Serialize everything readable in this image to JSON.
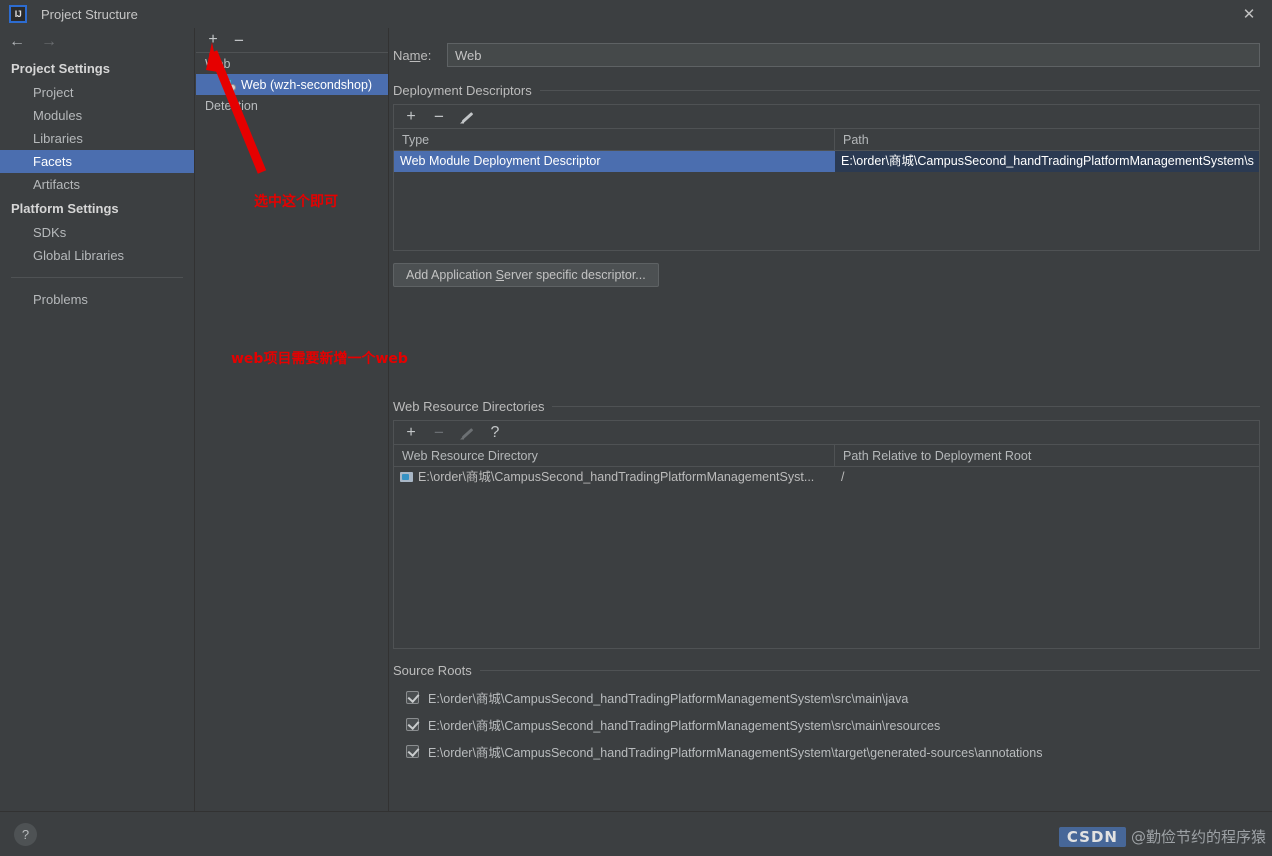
{
  "window": {
    "title": "Project Structure",
    "logo_text": "IJ",
    "close_icon": "✕"
  },
  "nav": {
    "back_icon": "←",
    "forward_icon": "→"
  },
  "sidebar": {
    "groups": [
      {
        "title": "Project Settings",
        "items": [
          {
            "label": "Project",
            "selected": false
          },
          {
            "label": "Modules",
            "selected": false
          },
          {
            "label": "Libraries",
            "selected": false
          },
          {
            "label": "Facets",
            "selected": true
          },
          {
            "label": "Artifacts",
            "selected": false
          }
        ]
      },
      {
        "title": "Platform Settings",
        "items": [
          {
            "label": "SDKs",
            "selected": false
          },
          {
            "label": "Global Libraries",
            "selected": false
          }
        ]
      }
    ],
    "problems_label": "Problems"
  },
  "tree": {
    "toolbar": {
      "add_icon": "+",
      "remove_icon": "−"
    },
    "nodes": [
      {
        "label": "Web",
        "level": 0,
        "selected": false,
        "icon": false
      },
      {
        "label": "Web (wzh-secondshop)",
        "level": 1,
        "selected": true,
        "icon": true
      },
      {
        "label": "Detection",
        "level": 0,
        "selected": false,
        "icon": false
      }
    ]
  },
  "facet": {
    "name_label": "Name:",
    "name_value": "Web",
    "deployment": {
      "section_title": "Deployment Descriptors",
      "toolbar": {
        "add_icon": "+",
        "remove_icon": "−",
        "edit_icon": "pencil"
      },
      "columns": [
        "Type",
        "Path"
      ],
      "rows": [
        {
          "type": "Web Module Deployment Descriptor",
          "path": "E:\\order\\商城\\CampusSecond_handTradingPlatformManagementSystem\\s",
          "selected": true
        }
      ],
      "add_descriptor_button": "Add Application Server specific descriptor..."
    },
    "web_resources": {
      "section_title": "Web Resource Directories",
      "toolbar": {
        "add_icon": "+",
        "remove_icon": "−",
        "edit_icon": "pencil",
        "help_icon": "?"
      },
      "columns": [
        "Web Resource Directory",
        "Path Relative to Deployment Root"
      ],
      "rows": [
        {
          "directory": "E:\\order\\商城\\CampusSecond_handTradingPlatformManagementSyst...",
          "relative_path": "/"
        }
      ]
    },
    "source_roots": {
      "section_title": "Source Roots",
      "items": [
        {
          "path": "E:\\order\\商城\\CampusSecond_handTradingPlatformManagementSystem\\src\\main\\java",
          "checked": true
        },
        {
          "path": "E:\\order\\商城\\CampusSecond_handTradingPlatformManagementSystem\\src\\main\\resources",
          "checked": true
        },
        {
          "path": "E:\\order\\商城\\CampusSecond_handTradingPlatformManagementSystem\\target\\generated-sources\\annotations",
          "checked": true
        }
      ]
    }
  },
  "footer": {
    "help_icon": "?"
  },
  "annotations": {
    "color": "#e60000",
    "note_top": "选中这个即可",
    "note_bottom": "web项目需要新增一个web"
  },
  "watermark": {
    "badge": "CSDN",
    "text": "@勤俭节约的程序猿"
  }
}
